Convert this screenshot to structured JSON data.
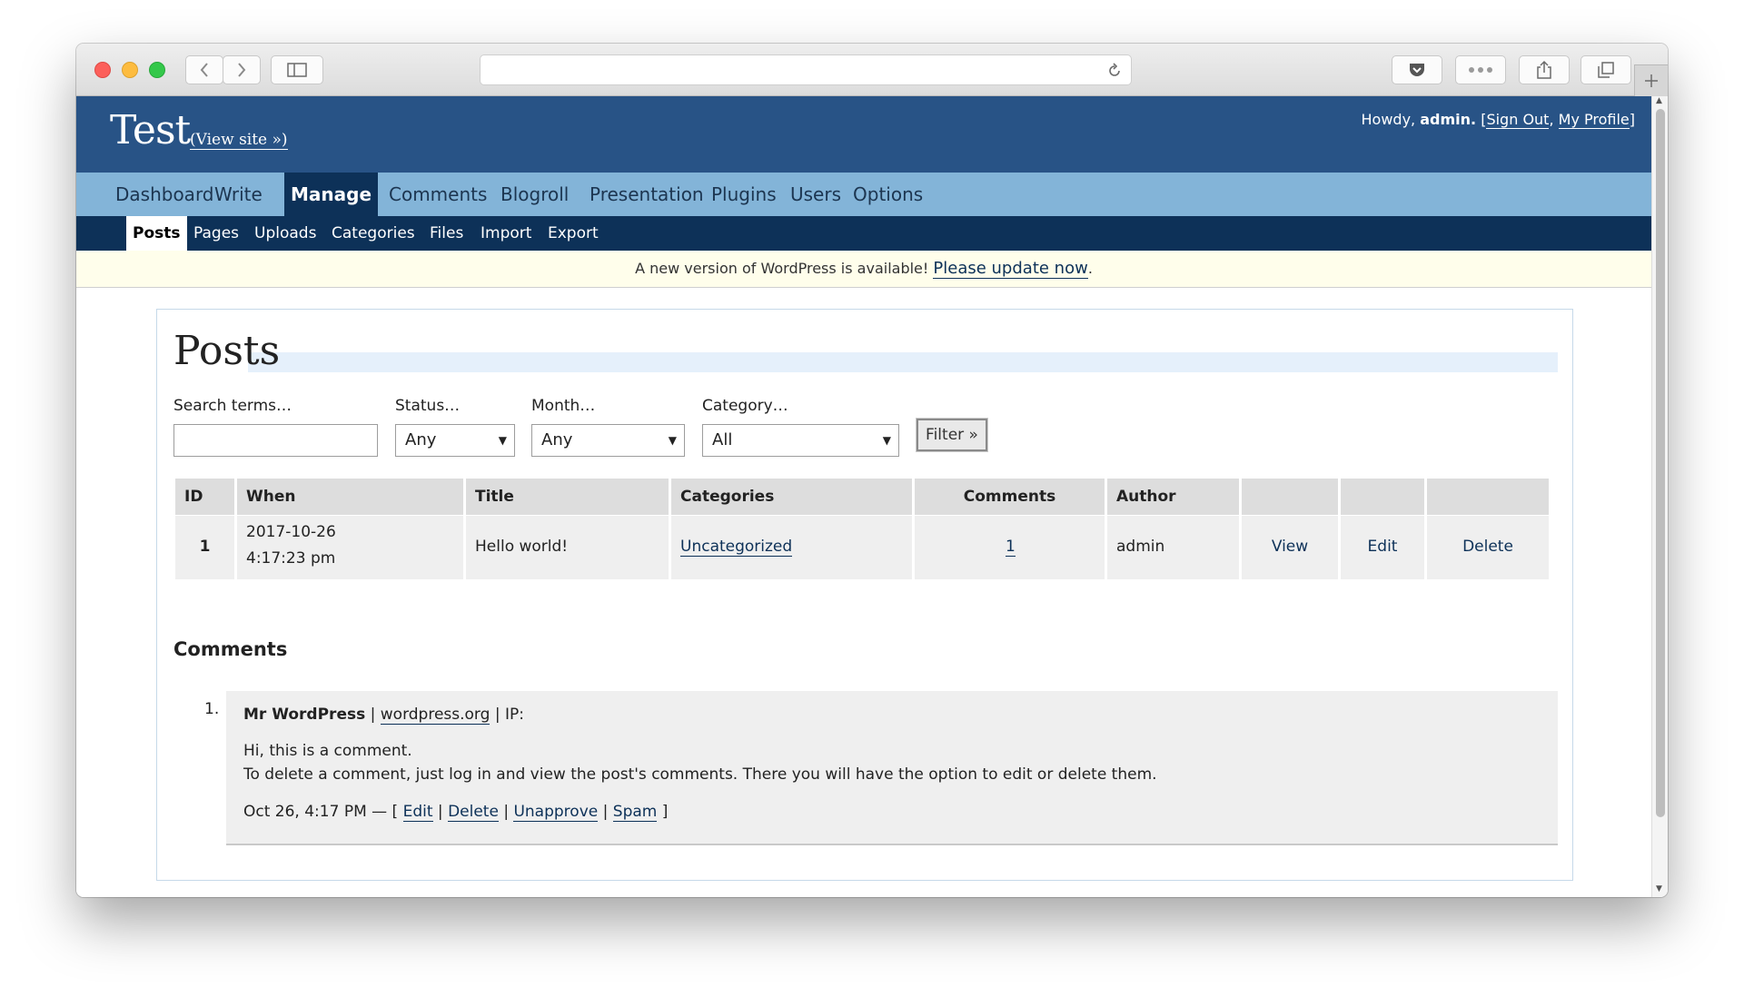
{
  "site": {
    "title": "Test",
    "view_site": "(View site »)"
  },
  "user_bar": {
    "howdy": "Howdy,",
    "username": "admin.",
    "open_bracket": "[",
    "sign_out": "Sign Out",
    "comma": ",",
    "my_profile": "My Profile",
    "close_bracket": "]"
  },
  "main_nav": [
    "Dashboard",
    "Write",
    "Manage",
    "Comments",
    "Blogroll",
    "Presentation",
    "Plugins",
    "Users",
    "Options"
  ],
  "sub_nav": [
    "Posts",
    "Pages",
    "Uploads",
    "Categories",
    "Files",
    "Import",
    "Export"
  ],
  "notice": {
    "text": "A new version of WordPress is available!",
    "link": "Please update now",
    "end": "."
  },
  "page_title": "Posts",
  "filters": {
    "search_label": "Search terms…",
    "status_label": "Status…",
    "status_value": "Any",
    "month_label": "Month…",
    "month_value": "Any",
    "category_label": "Category…",
    "category_value": "All",
    "filter_button": "Filter »"
  },
  "table": {
    "headers": [
      "ID",
      "When",
      "Title",
      "Categories",
      "Comments",
      "Author"
    ],
    "rows": [
      {
        "id": "1",
        "date": "2017-10-26",
        "time": "4:17:23 pm",
        "title": "Hello world!",
        "category": "Uncategorized",
        "comments": "1",
        "author": "admin",
        "view": "View",
        "edit": "Edit",
        "delete": "Delete"
      }
    ]
  },
  "comments_section": {
    "heading": "Comments",
    "items": [
      {
        "number": "1.",
        "author": "Mr WordPress",
        "sep1": "|",
        "url": "wordpress.org",
        "ip": "| IP:",
        "line1": "Hi, this is a comment.",
        "line2": "To delete a comment, just log in and view the post's comments. There you will have the option to edit or delete them.",
        "date": "Oct 26, 4:17 PM — [",
        "edit": "Edit",
        "delete": "Delete",
        "unapprove": "Unapprove",
        "spam": "Spam",
        "pipe": "|",
        "end": "]"
      }
    ]
  }
}
